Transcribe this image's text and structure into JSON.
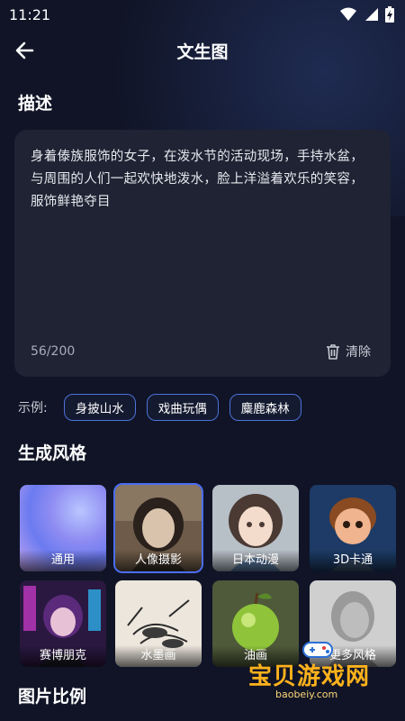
{
  "status": {
    "time": "11:21"
  },
  "header": {
    "title": "文生图"
  },
  "description": {
    "heading": "描述",
    "text": "身着傣族服饰的女子，在泼水节的活动现场，手持水盆，与周围的人们一起欢快地泼水，脸上洋溢着欢乐的笑容，服饰鲜艳夺目",
    "counter": "56/200",
    "clear_label": "清除"
  },
  "examples": {
    "label": "示例:",
    "chips": [
      "身披山水",
      "戏曲玩偶",
      "麋鹿森林"
    ]
  },
  "styles": {
    "heading": "生成风格",
    "items": [
      {
        "label": "通用",
        "selected": false
      },
      {
        "label": "人像摄影",
        "selected": true
      },
      {
        "label": "日本动漫",
        "selected": false
      },
      {
        "label": "3D卡通",
        "selected": false
      },
      {
        "label": "赛博朋克",
        "selected": false
      },
      {
        "label": "水墨画",
        "selected": false
      },
      {
        "label": "油画",
        "selected": false
      },
      {
        "label": "更多风格",
        "selected": false
      }
    ]
  },
  "ratio": {
    "heading": "图片比例"
  },
  "watermark": {
    "text": "宝贝游戏网",
    "url": "baobeiy.com"
  },
  "colors": {
    "accent": "#4b6ef5",
    "chip_border": "#4d72d9",
    "card": "#1f2333",
    "background": "#101426"
  }
}
